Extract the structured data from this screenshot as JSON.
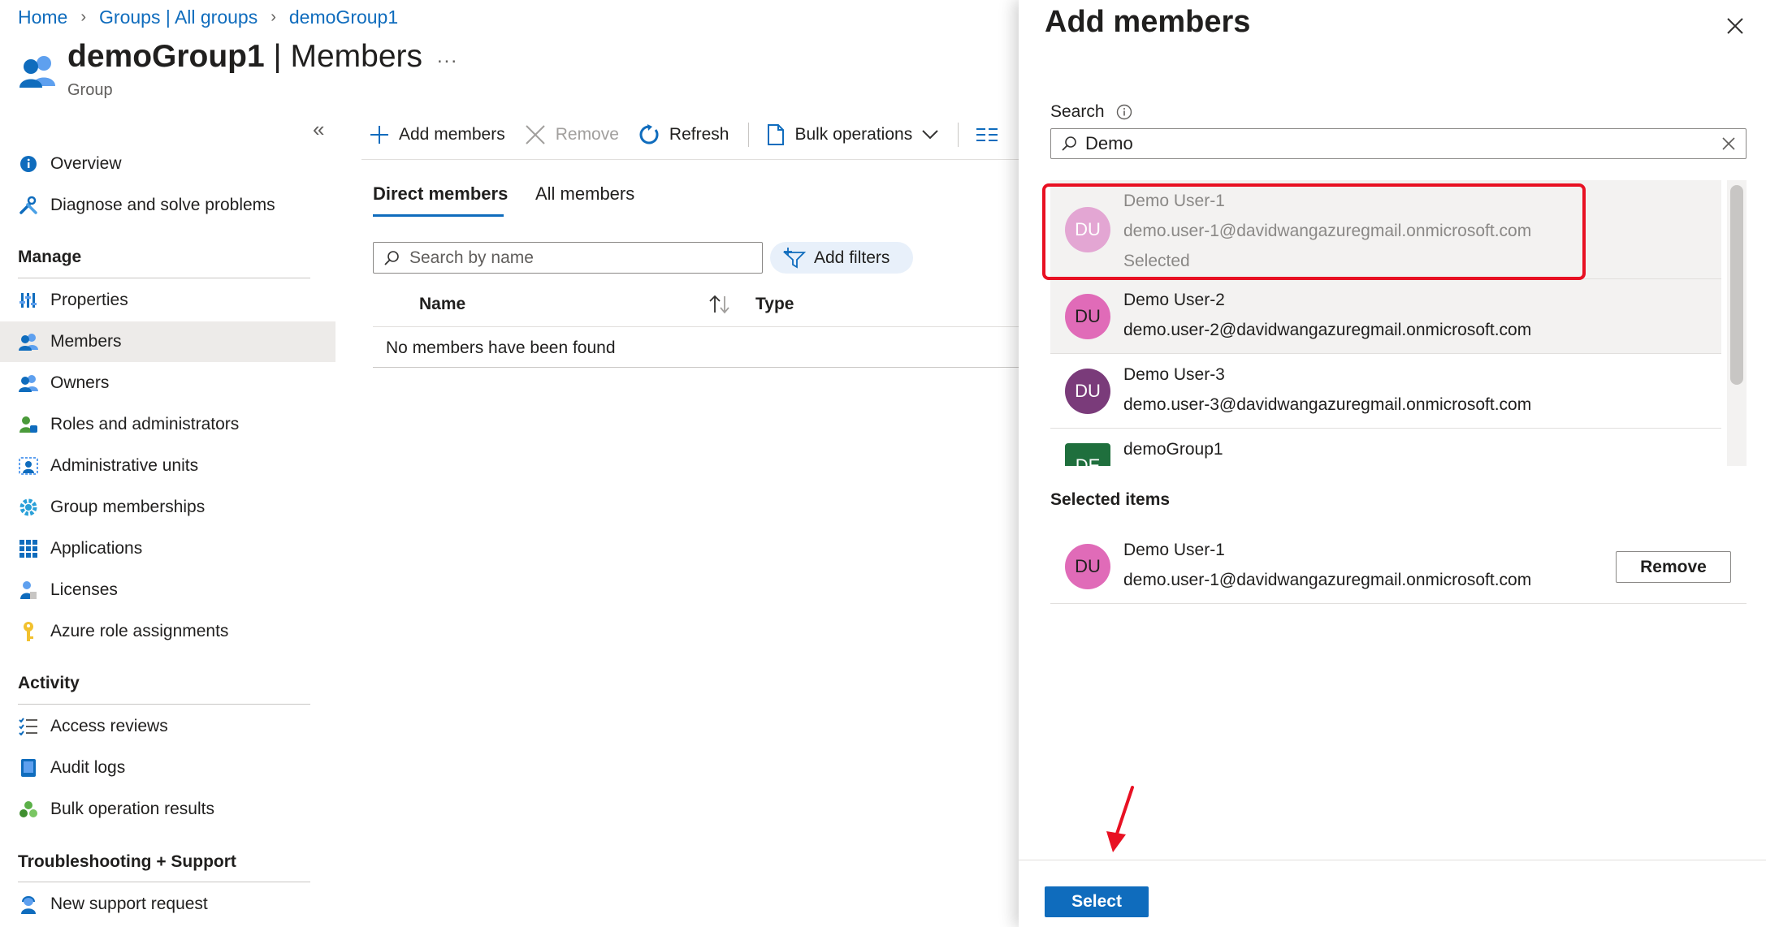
{
  "breadcrumb": {
    "home": "Home",
    "groups": "Groups | All groups",
    "current": "demoGroup1"
  },
  "header": {
    "title_bold": "demoGroup1",
    "title_rest": " | Members",
    "subtitle": "Group",
    "more": "..."
  },
  "sidebar": {
    "collapse": "«",
    "top_items": [
      {
        "label": "Overview",
        "icon": "info-icon"
      },
      {
        "label": "Diagnose and solve problems",
        "icon": "wrench-icon"
      }
    ],
    "manage_title": "Manage",
    "manage_items": [
      {
        "label": "Properties",
        "icon": "properties-icon"
      },
      {
        "label": "Members",
        "icon": "members-icon"
      },
      {
        "label": "Owners",
        "icon": "owners-icon"
      },
      {
        "label": "Roles and administrators",
        "icon": "roles-icon"
      },
      {
        "label": "Administrative units",
        "icon": "admin-units-icon"
      },
      {
        "label": "Group memberships",
        "icon": "gear-icon"
      },
      {
        "label": "Applications",
        "icon": "grid-icon"
      },
      {
        "label": "Licenses",
        "icon": "license-icon"
      },
      {
        "label": "Azure role assignments",
        "icon": "key-icon"
      }
    ],
    "activity_title": "Activity",
    "activity_items": [
      {
        "label": "Access reviews",
        "icon": "checklist-icon"
      },
      {
        "label": "Audit logs",
        "icon": "book-icon"
      },
      {
        "label": "Bulk operation results",
        "icon": "cluster-icon"
      }
    ],
    "support_title": "Troubleshooting + Support",
    "support_items": [
      {
        "label": "New support request",
        "icon": "support-icon"
      }
    ]
  },
  "toolbar": {
    "add": "Add members",
    "remove": "Remove",
    "refresh": "Refresh",
    "bulk": "Bulk operations"
  },
  "tabs": {
    "direct": "Direct members",
    "all": "All members"
  },
  "filters": {
    "search_placeholder": "Search by name",
    "add_filters": "Add filters"
  },
  "table": {
    "col_name": "Name",
    "col_type": "Type",
    "empty": "No members have been found"
  },
  "panel": {
    "title": "Add members",
    "search_label": "Search",
    "search_value": "Demo",
    "results": [
      {
        "initials": "DU",
        "name": "Demo User-1",
        "email": "demo.user-1@davidwangazuregmail.onmicrosoft.com",
        "status": "Selected",
        "color": "#e3a6d3"
      },
      {
        "initials": "DU",
        "name": "Demo User-2",
        "email": "demo.user-2@davidwangazuregmail.onmicrosoft.com",
        "color": "#e06bb8"
      },
      {
        "initials": "DU",
        "name": "Demo User-3",
        "email": "demo.user-3@davidwangazuregmail.onmicrosoft.com",
        "color": "#7a3b7a"
      },
      {
        "initials": "DE",
        "name": "demoGroup1",
        "color": "#1f6f3d"
      }
    ],
    "selected_title": "Selected items",
    "selected": {
      "initials": "DU",
      "name": "Demo User-1",
      "email": "demo.user-1@davidwangazuregmail.onmicrosoft.com",
      "color": "#e06bb8"
    },
    "remove_label": "Remove",
    "select_label": "Select"
  },
  "colors": {
    "accent": "#0f6cbd",
    "highlight": "#e81123"
  }
}
